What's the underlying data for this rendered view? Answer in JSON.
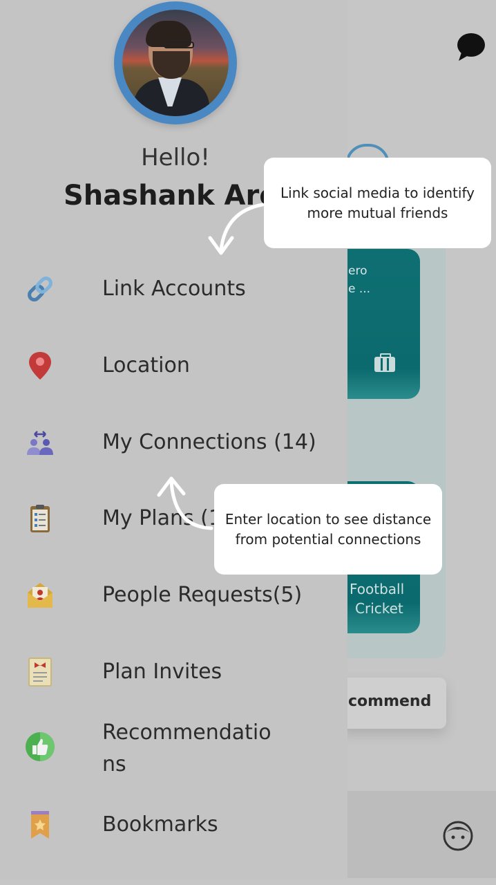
{
  "drawer": {
    "greeting": "Hello!",
    "user_name": "Shashank Aror",
    "menu": [
      {
        "label": "Link Accounts",
        "icon": "link-icon"
      },
      {
        "label": "Location",
        "icon": "location-pin-icon"
      },
      {
        "label": "My Connections (14)",
        "icon": "connections-icon"
      },
      {
        "label": "My Plans (1",
        "icon": "clipboard-icon"
      },
      {
        "label": "People Requests(5)",
        "icon": "envelope-request-icon"
      },
      {
        "label": "Plan Invites",
        "icon": "invite-card-icon"
      },
      {
        "label": "Recommendations",
        "label_line1": "Recommendatio",
        "label_line2": "ns",
        "icon": "thumbs-up-icon"
      },
      {
        "label": "Bookmarks",
        "icon": "bookmark-icon"
      }
    ]
  },
  "background": {
    "card1_line1": "ero",
    "card1_line2": "e ...",
    "card2_line1": "Football",
    "card2_line2": "Cricket",
    "recommend_label": "commend"
  },
  "tooltips": {
    "link_accounts": "Link social media to identify more mutual friends",
    "location": "Enter location to see distance from potential connections"
  },
  "colors": {
    "teal_card": "#0e6f72",
    "avatar_ring": "#4a88c4",
    "overlay": "#c4c4c4"
  }
}
